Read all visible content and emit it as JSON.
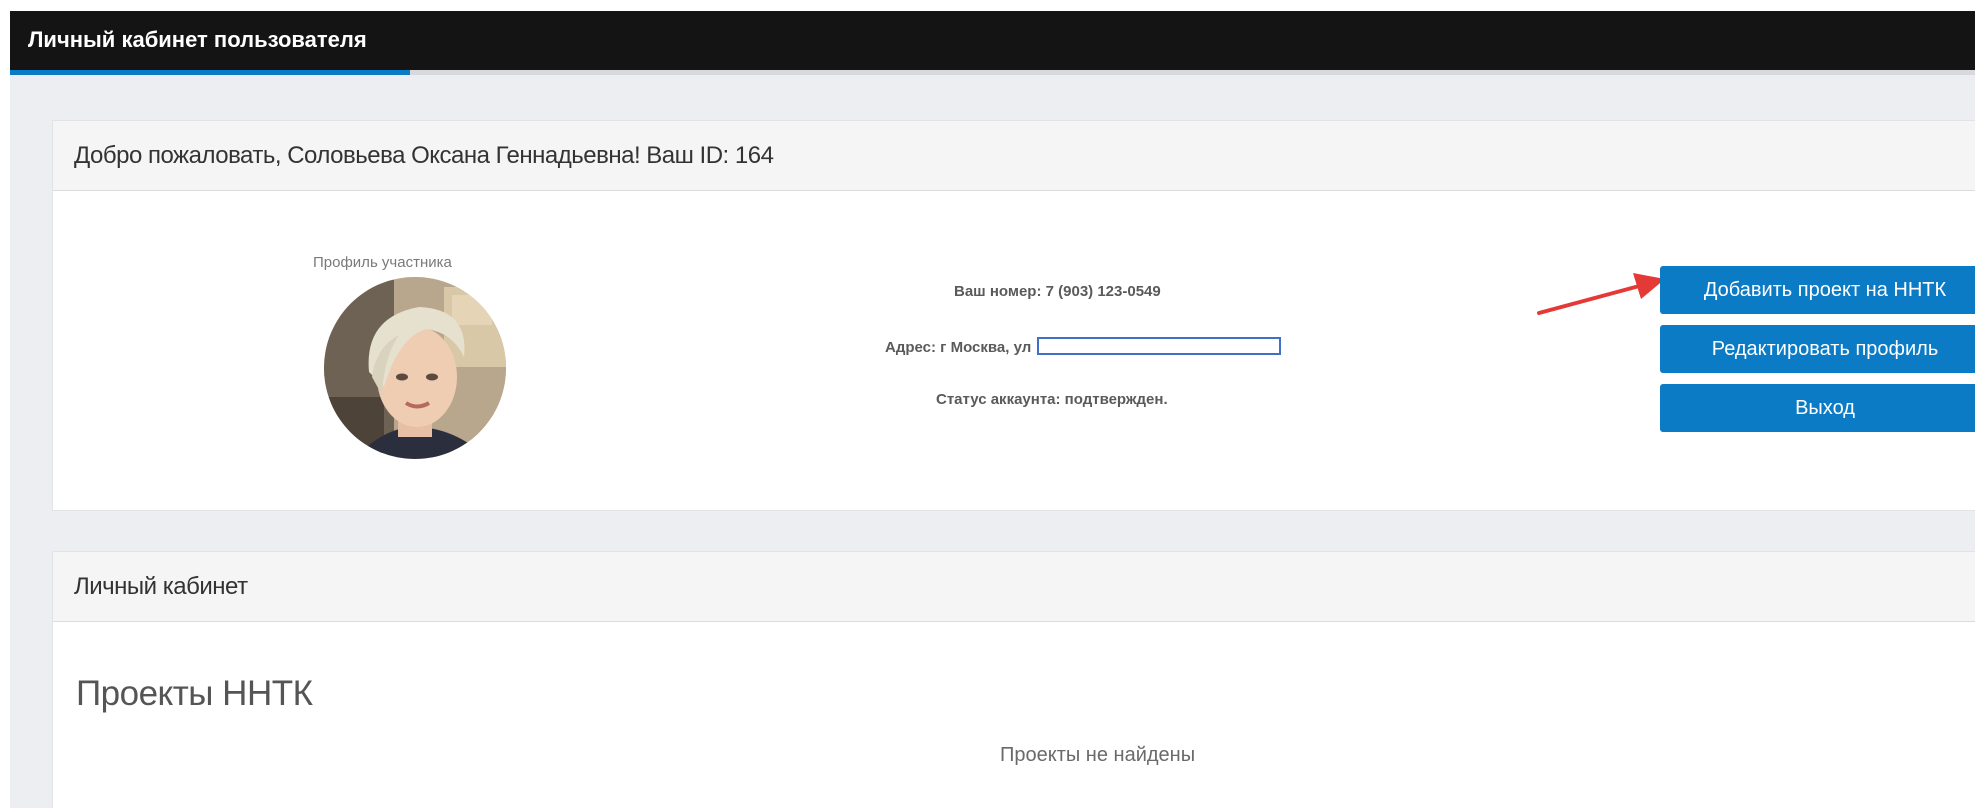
{
  "header": {
    "title": "Личный кабинет пользователя"
  },
  "profile_panel": {
    "title": "Добро пожаловать, Соловьева Оксана Геннадьевна! Ваш ID: 164",
    "profile_caption": "Профиль участника",
    "phone_line": "Ваш номер: 7 (903) 123-0549",
    "address_line": "Адрес: г Москва, ул",
    "status_line": "Статус аккаунта: подтвержден.",
    "buttons": {
      "add_project": "Добавить проект на ННТК",
      "edit_profile": "Редактировать профиль",
      "logout": "Выход"
    }
  },
  "cabinet_panel": {
    "title": "Личный кабинет",
    "projects_heading": "Проекты ННТК",
    "projects_empty": "Проекты не найдены"
  },
  "colors": {
    "topbar": "#141414",
    "accent": "#0b7bc5",
    "background": "#eceef2",
    "annotation_arrow": "#e53935"
  },
  "icons": {
    "annotation": "red-arrow-icon"
  }
}
